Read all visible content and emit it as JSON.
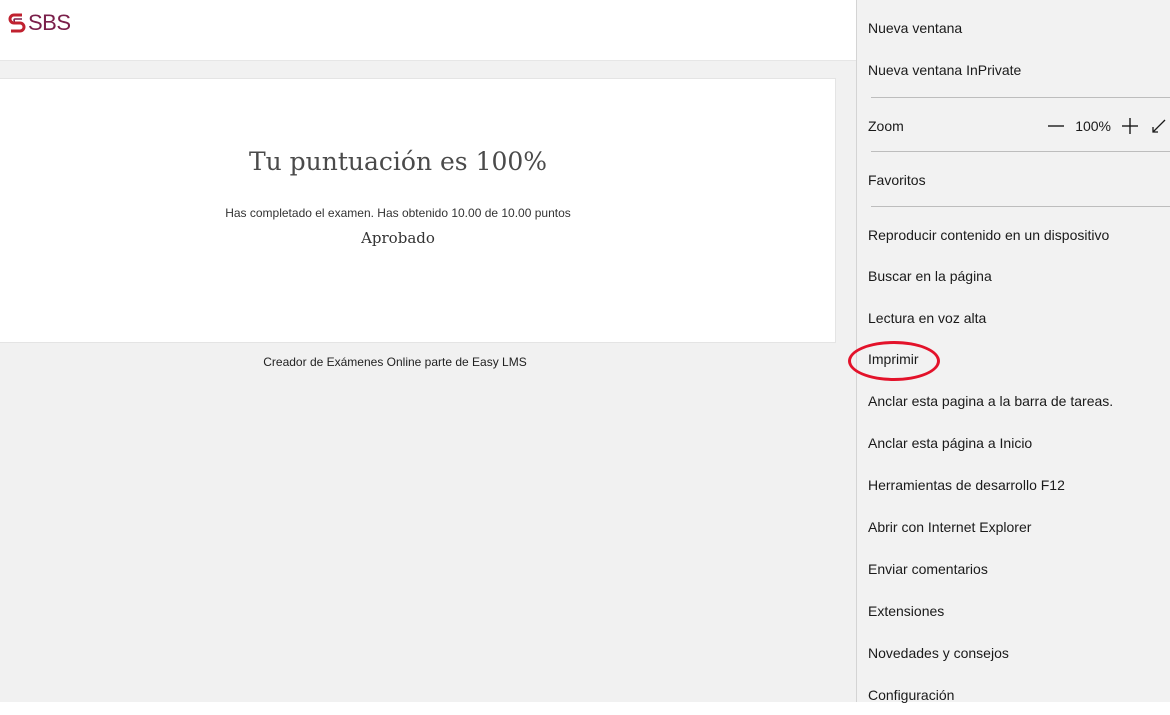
{
  "logo": {
    "text": "SBS"
  },
  "result": {
    "title": "Tu puntuación es 100%",
    "completed": "Has completado el examen. Has obtenido 10.00 de 10.00 puntos",
    "status": "Aprobado"
  },
  "footer": {
    "link": "Creador de Exámenes Online parte de Easy LMS"
  },
  "menu": {
    "items": [
      "Nueva ventana",
      "Nueva ventana InPrivate",
      "Zoom",
      "Favoritos",
      "Reproducir contenido en un dispositivo",
      "Buscar en la página",
      "Lectura en voz alta",
      "Imprimir",
      "Anclar esta pagina a la barra de tareas.",
      "Anclar esta página a Inicio",
      "Herramientas de desarrollo F12",
      "Abrir con Internet Explorer",
      "Enviar comentarios",
      "Extensiones",
      "Novedades y consejos",
      "Configuración"
    ],
    "zoom_value": "100%"
  },
  "colors": {
    "brand": "#7a1f4a",
    "highlight": "#e3122a"
  },
  "icons": [
    "zoom-out-icon",
    "zoom-in-icon",
    "fullscreen-icon"
  ]
}
